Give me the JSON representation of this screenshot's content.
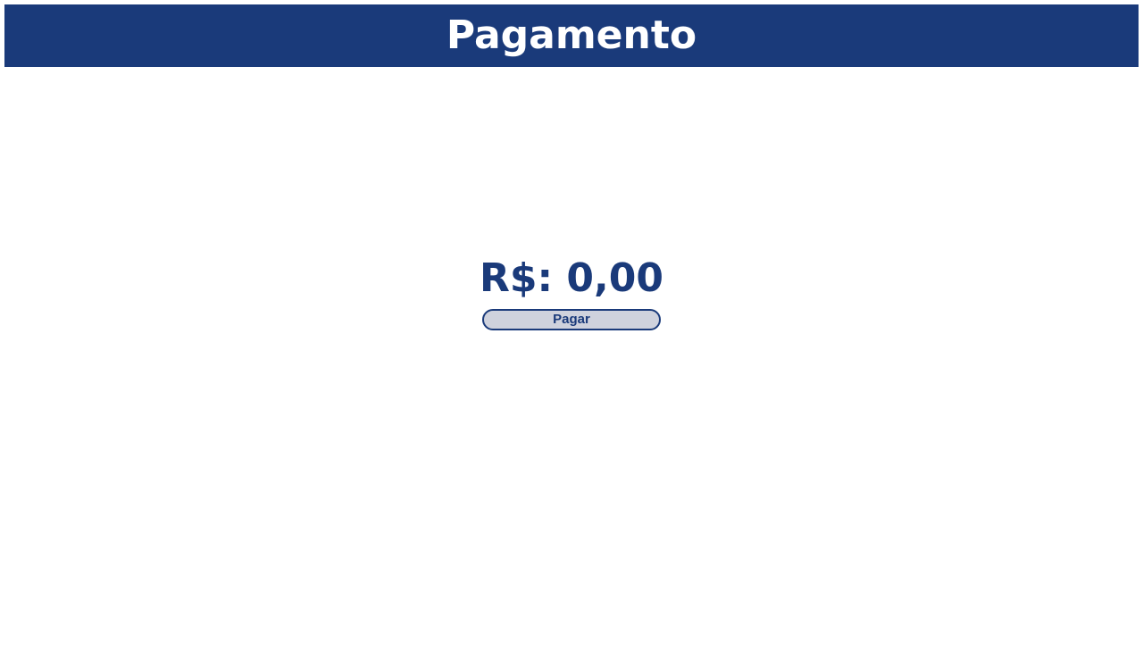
{
  "header": {
    "title": "Pagamento"
  },
  "payment": {
    "amount_label": "R$: 0,00",
    "pay_button_label": "Pagar"
  },
  "colors": {
    "brand": "#1a3a7a",
    "button_bg": "#cfd2dd",
    "background": "#ffffff"
  }
}
